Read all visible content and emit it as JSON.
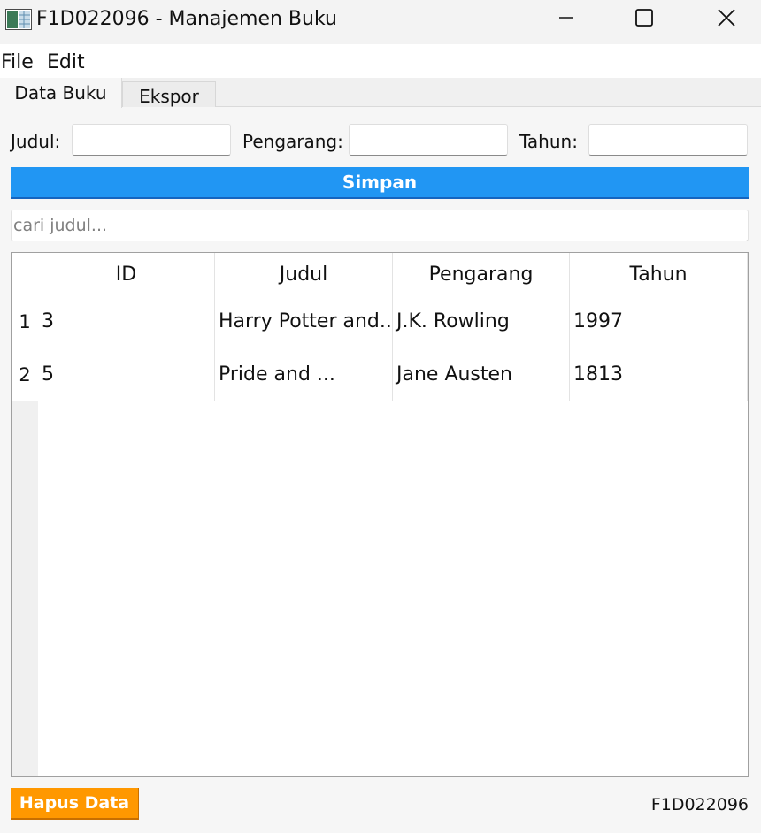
{
  "window": {
    "title": "F1D022096 - Manajemen Buku",
    "app_icon": "spreadsheet-app-icon",
    "controls": [
      "minimize-icon",
      "maximize-icon",
      "close-icon"
    ]
  },
  "menubar": {
    "items": [
      {
        "label": "File"
      },
      {
        "label": "Edit"
      }
    ]
  },
  "tabs": [
    {
      "label": "Data Buku",
      "active": true
    },
    {
      "label": "Ekspor",
      "active": false
    }
  ],
  "form": {
    "judul_label": "Judul:",
    "judul_value": "",
    "pengarang_label": "Pengarang:",
    "pengarang_value": "",
    "tahun_label": "Tahun:",
    "tahun_value": "",
    "save_label": "Simpan"
  },
  "search": {
    "placeholder": "cari judul...",
    "value": ""
  },
  "table": {
    "columns": [
      "ID",
      "Judul",
      "Pengarang",
      "Tahun"
    ],
    "rows": [
      {
        "num": "1",
        "cells": [
          "3",
          "Harry Potter and...",
          "J.K. Rowling",
          "1997"
        ]
      },
      {
        "num": "2",
        "cells": [
          "5",
          "Pride and ...",
          "Jane Austen",
          "1813"
        ]
      }
    ]
  },
  "footer": {
    "delete_label": "Hapus Data",
    "status_text": "F1D022096"
  },
  "colors": {
    "save_button": "#2196f3",
    "delete_button": "#ff9800"
  }
}
